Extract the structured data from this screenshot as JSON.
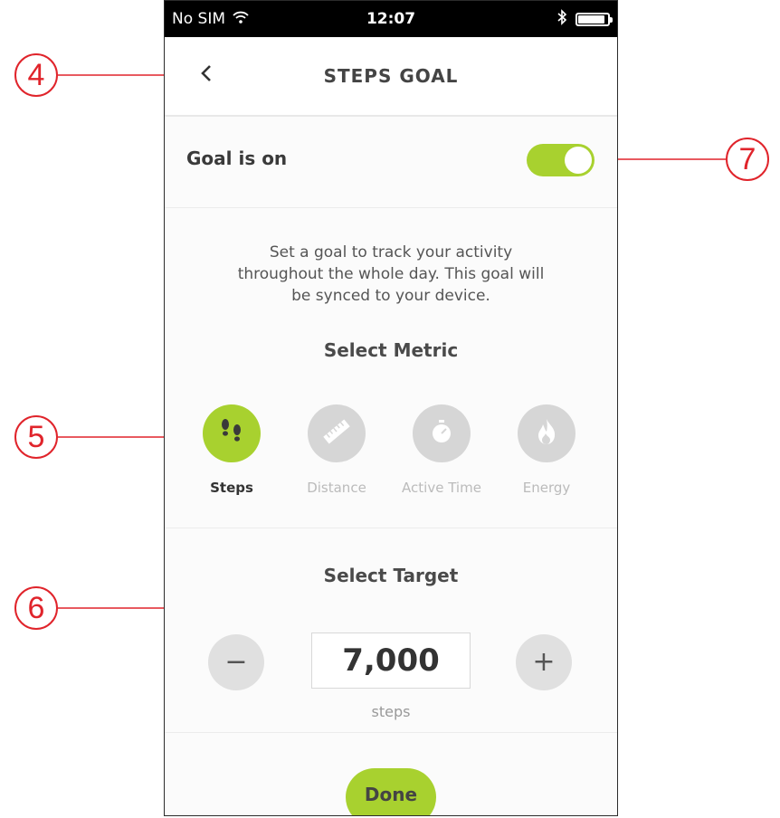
{
  "colors": {
    "accent": "#a8d12f",
    "inactive_circle": "#d6d6d6",
    "callout_red": "#e0242b"
  },
  "status_bar": {
    "carrier": "No SIM",
    "time": "12:07",
    "icons": [
      "wifi-icon",
      "bluetooth-icon",
      "battery-icon"
    ],
    "battery_level": 0.85
  },
  "nav": {
    "back_icon": "chevron-left-icon",
    "title": "STEPS GOAL"
  },
  "goal": {
    "label": "Goal is on",
    "toggle_on": true
  },
  "description": [
    "Set a goal to track your activity",
    "throughout the whole day. This goal will",
    "be synced to your device."
  ],
  "metric_section": {
    "title": "Select Metric",
    "selected": "Steps",
    "items": [
      {
        "label": "Steps",
        "icon": "footsteps-icon",
        "selected": true
      },
      {
        "label": "Distance",
        "icon": "ruler-icon",
        "selected": false
      },
      {
        "label": "Active Time",
        "icon": "stopwatch-icon",
        "selected": false
      },
      {
        "label": "Energy",
        "icon": "flame-icon",
        "selected": false
      }
    ]
  },
  "target_section": {
    "title": "Select Target",
    "value": "7,000",
    "unit": "steps",
    "decrement_label": "−",
    "increment_label": "+"
  },
  "done_button": {
    "label": "Done"
  },
  "callouts": {
    "back": "4",
    "metric": "5",
    "stepper": "6",
    "toggle": "7"
  }
}
